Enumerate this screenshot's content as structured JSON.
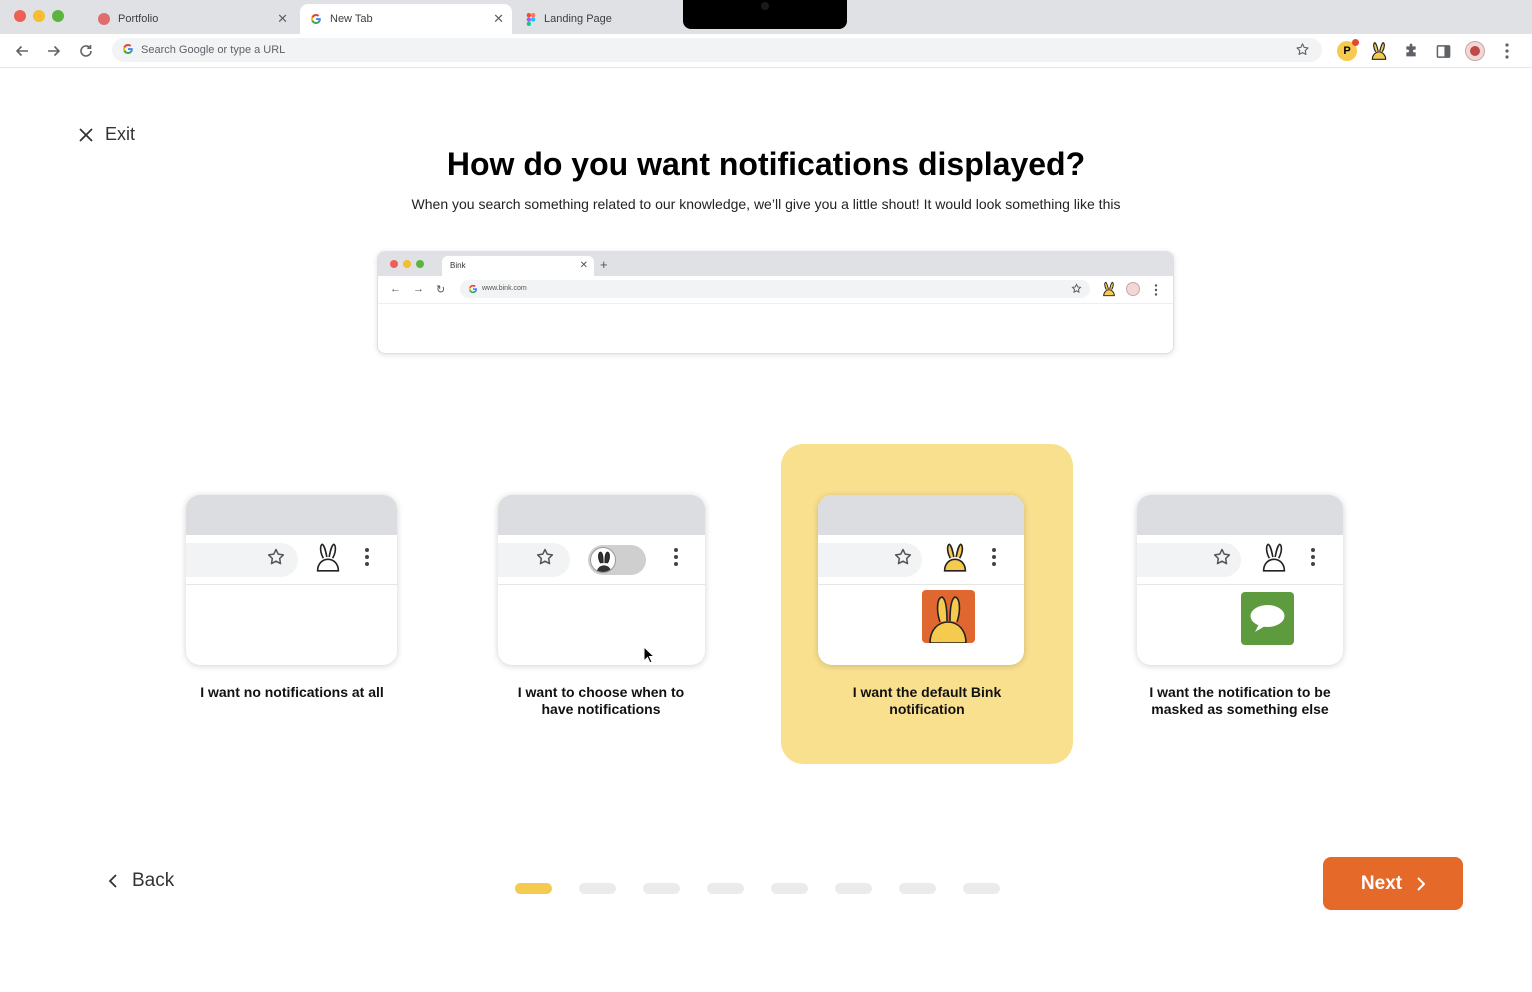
{
  "browser": {
    "tabs": [
      {
        "title": "Portfolio",
        "favicon": "portfolio-favicon",
        "color": "#e06c6c"
      },
      {
        "title": "New Tab",
        "favicon": "google-favicon",
        "active": true
      },
      {
        "title": "Landing Page",
        "favicon": "figma-favicon"
      }
    ],
    "omnibox_placeholder": "Search Google or type a URL",
    "profile_initial": "P"
  },
  "page": {
    "exit_label": "Exit",
    "title": "How do you want notifications displayed?",
    "subtitle": "When you search something related to our knowledge, we’ll give you a little shout! It would look something like this"
  },
  "preview": {
    "tab_title": "Bink",
    "url": "www.bink.com"
  },
  "options": [
    {
      "label": "I want no notifications at all",
      "selected": false
    },
    {
      "label": "I want to choose when to have notifications",
      "selected": false
    },
    {
      "label": "I want the default Bink notification",
      "selected": true
    },
    {
      "label": "I want the notification to be masked as something else",
      "selected": false
    }
  ],
  "footer": {
    "back_label": "Back",
    "next_label": "Next",
    "progress": {
      "current_step": 1,
      "total_steps": 8
    }
  },
  "colors": {
    "accent_orange": "#e56a2a",
    "selected_card": "#f9e08f",
    "progress_active": "#f6c94f",
    "masked_notif_green": "#5e9a3e"
  }
}
